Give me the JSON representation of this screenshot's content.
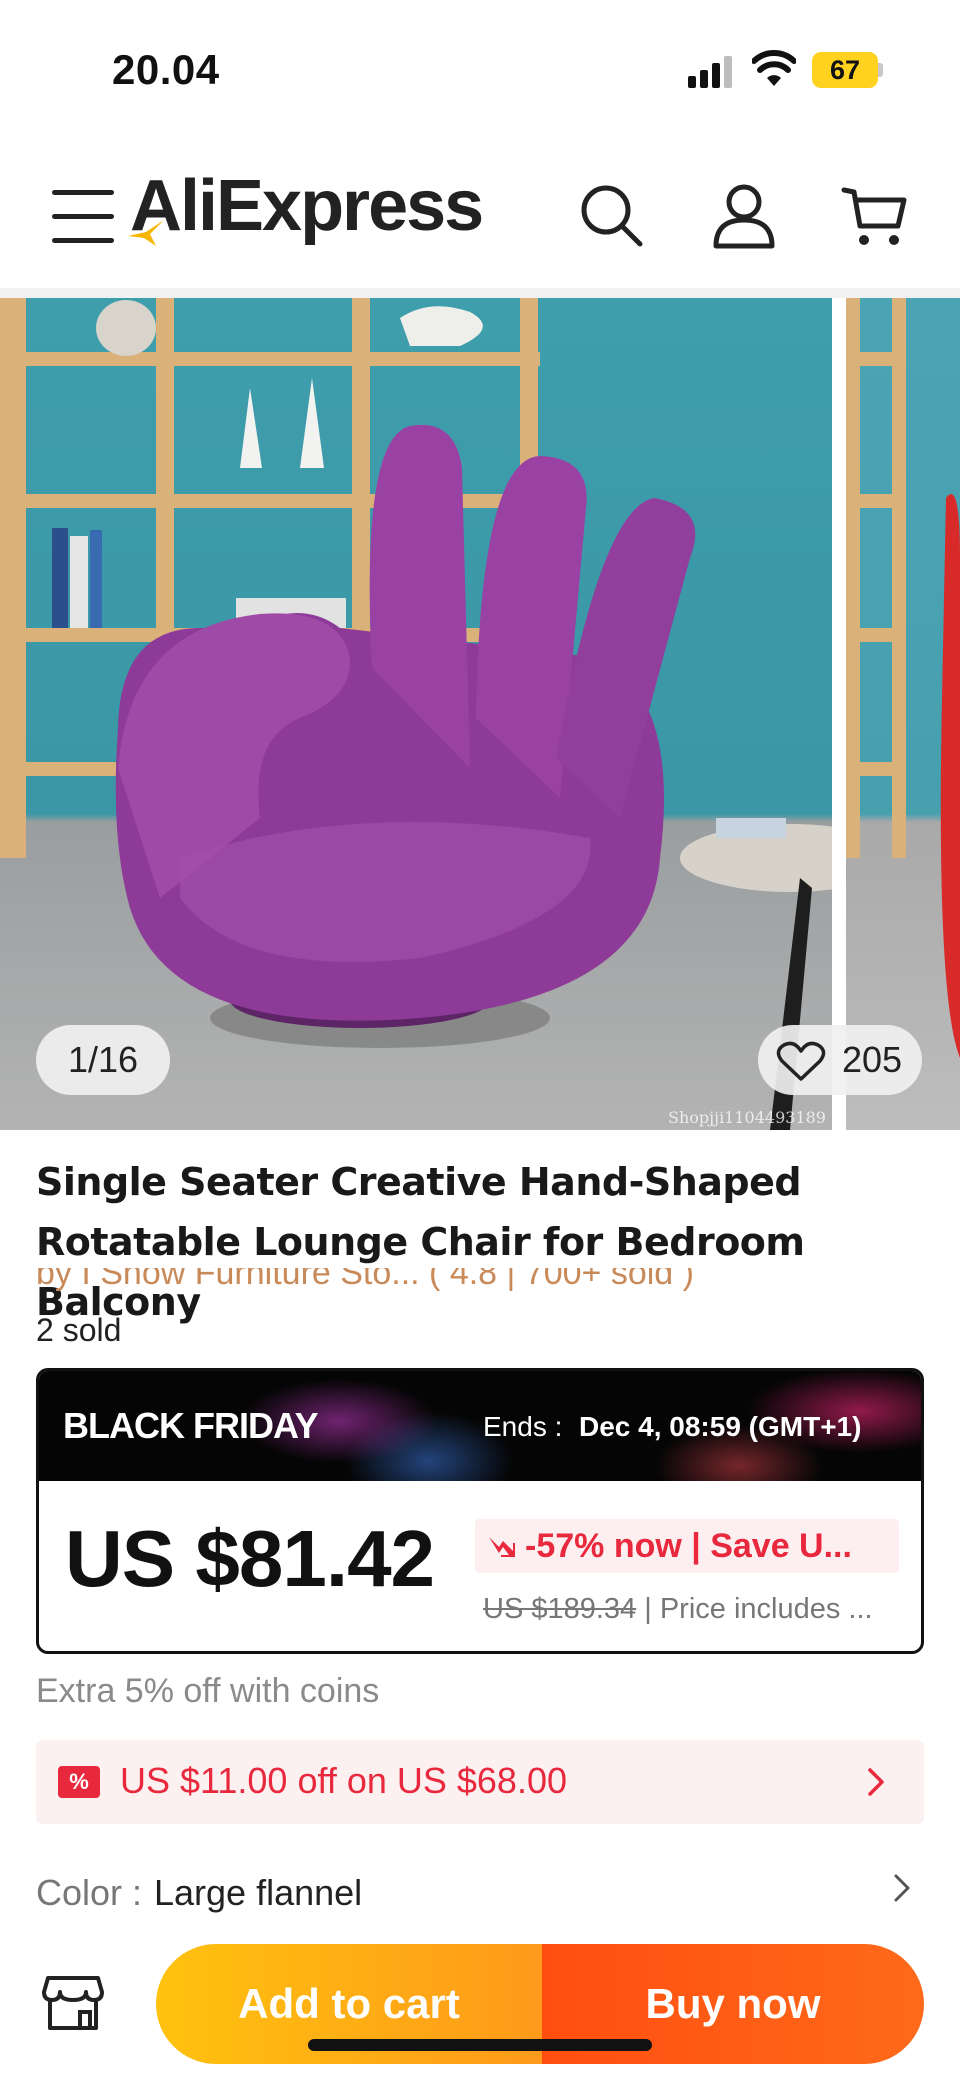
{
  "status_bar": {
    "time": "20.04",
    "battery": "67"
  },
  "header": {
    "logo_text": "AliExpress",
    "icons": [
      "menu-icon",
      "search-icon",
      "account-icon",
      "cart-icon"
    ]
  },
  "gallery": {
    "counter": "1/16",
    "wishlist_count": "205",
    "watermark": "Shopjji1104493189",
    "image_subject": "purple hand-shaped lounge chair"
  },
  "product": {
    "title": "Single Seater Creative Hand-Shaped Rotatable Lounge Chair for Bedroom Balcony",
    "store_line_partial": "by  I Show Furniture Sto...  (  4.8  |  700+ sold )",
    "sold": "2 sold"
  },
  "promo": {
    "title": "BLACK FRIDAY",
    "ends_label": "Ends :",
    "ends_value": "Dec 4, 08:59 (GMT+1)"
  },
  "price": {
    "current": "US $81.42",
    "discount": "-57% now | Save U...",
    "original": "US $189.34",
    "separator": "|",
    "note": "Price includes ..."
  },
  "coins": {
    "text": "Extra 5% off with coins"
  },
  "coupon": {
    "icon_text": "%",
    "text": "US $11.00 off on US $68.00"
  },
  "variant": {
    "label": "Color",
    "separator": ":",
    "value": "Large flannel"
  },
  "actions": {
    "add_to_cart": "Add to cart",
    "buy_now": "Buy now"
  },
  "colors": {
    "accent_red": "#e8283c",
    "cart_button": "#ffb414",
    "buy_button": "#ff5512",
    "battery": "#ffd21f"
  }
}
